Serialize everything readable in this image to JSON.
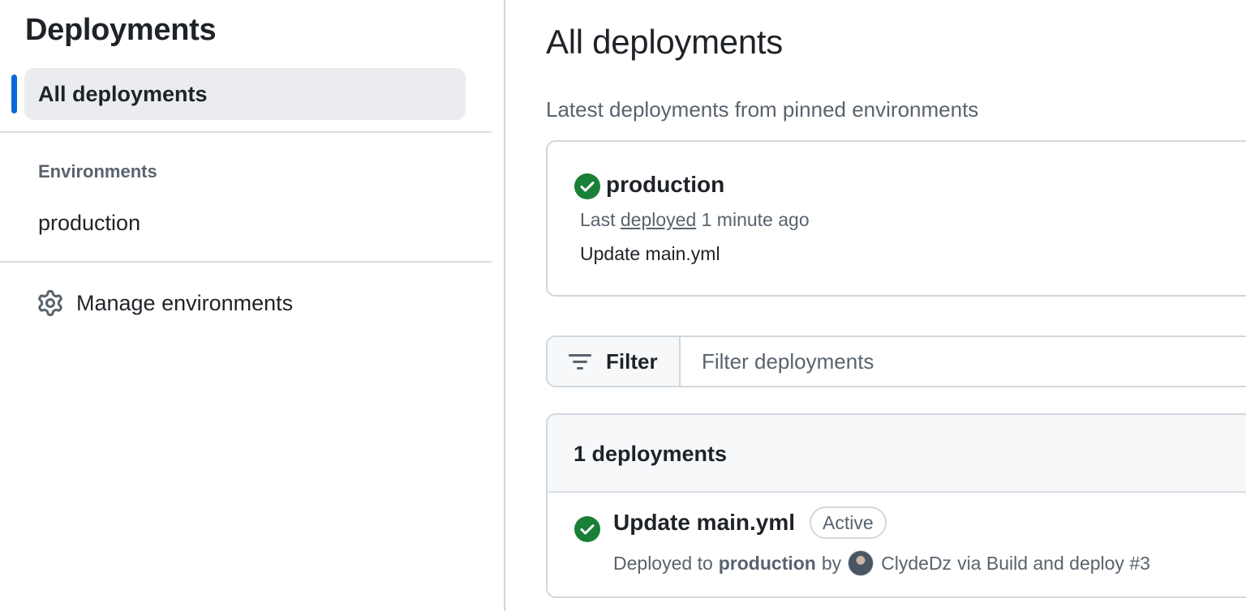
{
  "sidebar": {
    "title": "Deployments",
    "selected_item": "All deployments",
    "environments_heading": "Environments",
    "environments": [
      "production"
    ],
    "manage_label": "Manage environments",
    "manage_icon": "gear-icon"
  },
  "main": {
    "title": "All deployments",
    "subtitle": "Latest deployments from pinned environments",
    "pinned": {
      "environment": "production",
      "status_icon": "check-circle-icon",
      "meta_prefix": "Last",
      "meta_link": "deployed",
      "meta_time": "1 minute ago",
      "commit": "Update main.yml"
    },
    "filter": {
      "button_label": "Filter",
      "button_icon": "filter-icon",
      "placeholder": "Filter deployments"
    },
    "list": {
      "count_label": "1 deployments",
      "rows": [
        {
          "title": "Update main.yml",
          "badge": "Active",
          "status_icon": "check-circle-icon",
          "deployed_to_prefix": "Deployed to",
          "environment": "production",
          "by_label": "by",
          "actor": "ClydeDz",
          "via_text": "via Build and deploy #3"
        }
      ]
    }
  },
  "colors": {
    "accent": "#0969da",
    "success": "#1a7f37",
    "muted_text": "#59636e",
    "border": "#d0d7de",
    "selected_bg": "#eaecef"
  }
}
